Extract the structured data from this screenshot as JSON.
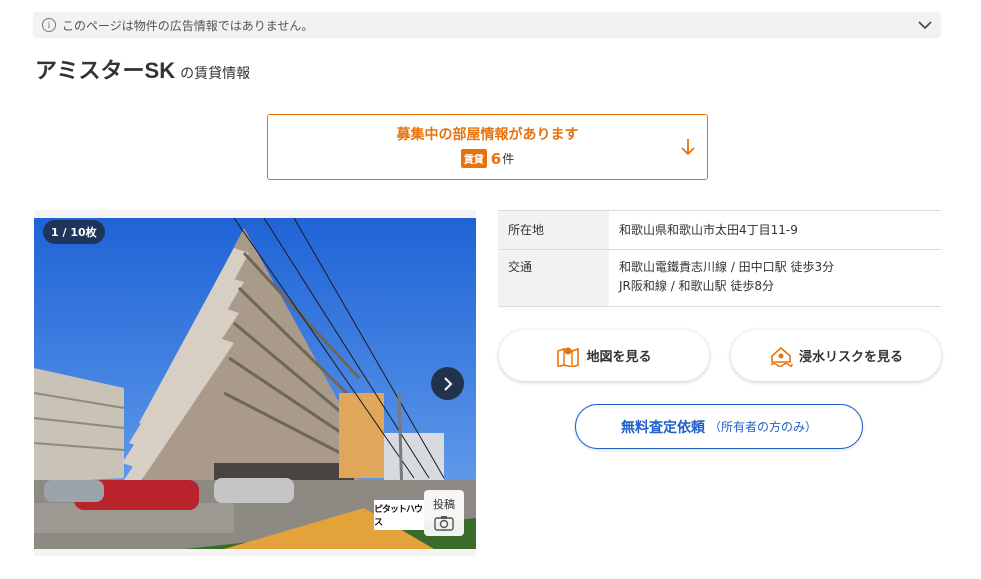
{
  "notice": {
    "icon": "info-icon",
    "text": "このページは物件の広告情報ではありません。"
  },
  "title": {
    "name": "アミスターSK",
    "suffix": "の賃貸情報"
  },
  "vacancy": {
    "title": "募集中の部屋情報があります",
    "badge": "賃貸",
    "count": "6",
    "unit": "件",
    "accent": "#e8730c"
  },
  "photo": {
    "counter": "1 / 10枚",
    "logo": "ピタットハウス",
    "post_label": "投稿"
  },
  "details": {
    "address_label": "所在地",
    "address_value": "和歌山県和歌山市太田4丁目11-9",
    "traffic_label": "交通",
    "traffic_line1": "和歌山電鐵貴志川線 / 田中口駅 徒歩3分",
    "traffic_line2": "JR阪和線 / 和歌山駅 徒歩8分"
  },
  "buttons": {
    "map_label": "地図を見る",
    "flood_label": "浸水リスクを見る",
    "assess_main": "無料査定依頼",
    "assess_sub": "（所有者の方のみ）"
  },
  "colors": {
    "orange": "#e8730c",
    "blue": "#2061c9",
    "navy": "#23324c"
  }
}
